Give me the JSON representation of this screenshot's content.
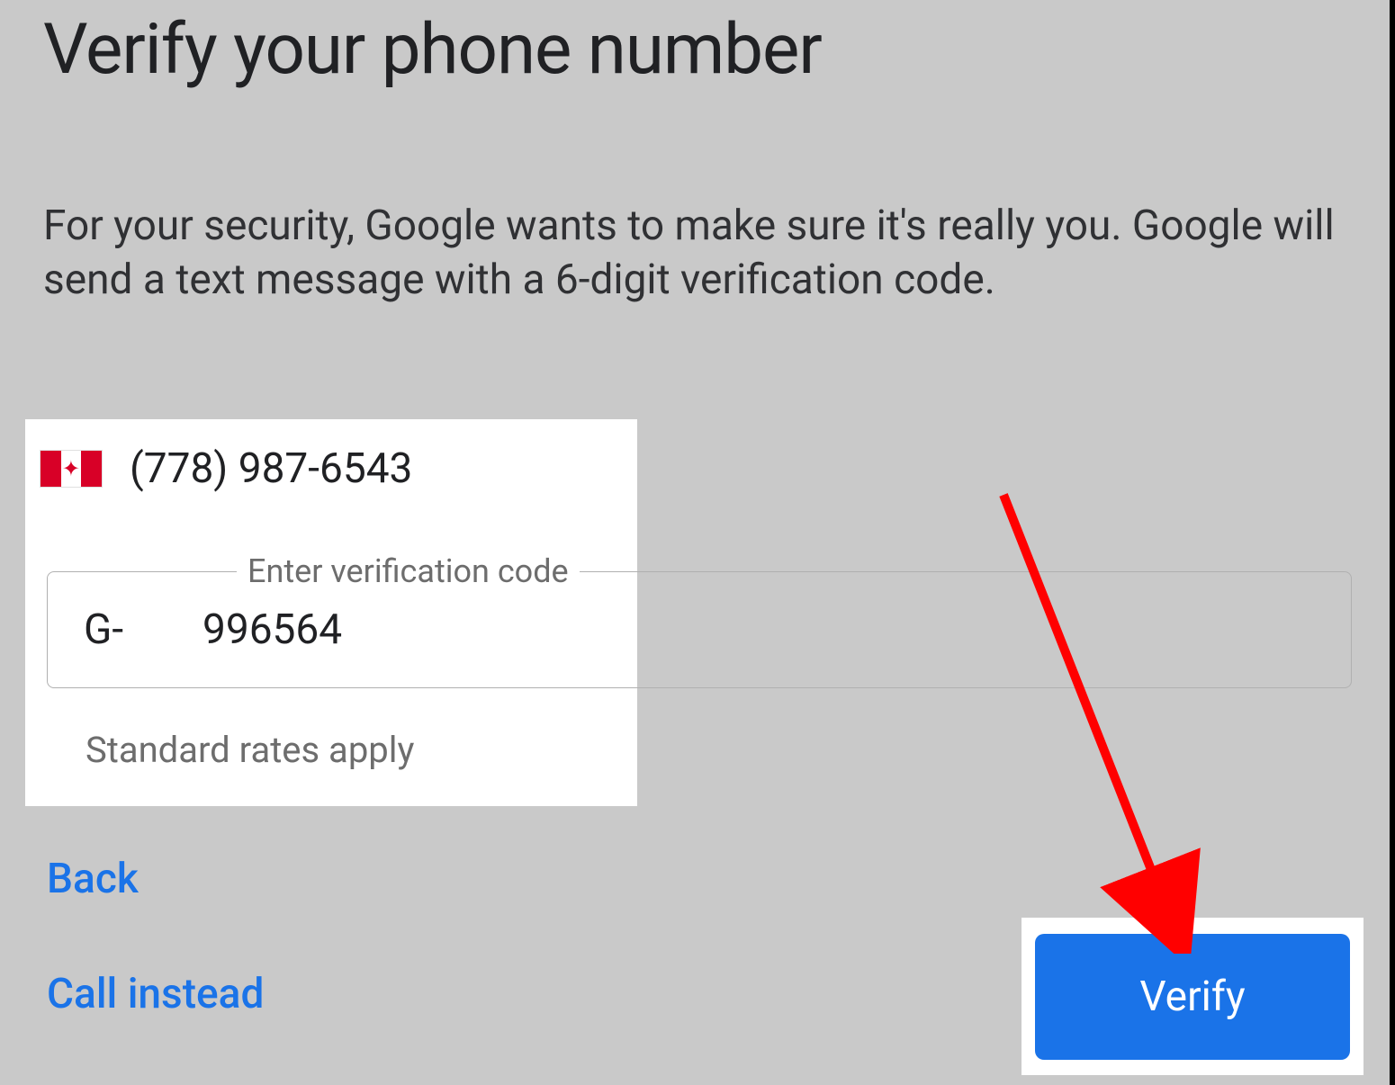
{
  "title": "Verify your phone number",
  "description": "For your security, Google wants to make sure it's really you. Google will send a text message with a 6-digit verification code.",
  "phone": {
    "country_flag": "canada-flag",
    "number": "(778) 987-6543"
  },
  "code_field": {
    "legend": "Enter verification code",
    "prefix": "G-",
    "value": "996564"
  },
  "rates_text": "Standard rates apply",
  "links": {
    "back": "Back",
    "call_instead": "Call instead"
  },
  "verify_button": "Verify",
  "annotation": {
    "arrow_color": "#ff0000"
  }
}
